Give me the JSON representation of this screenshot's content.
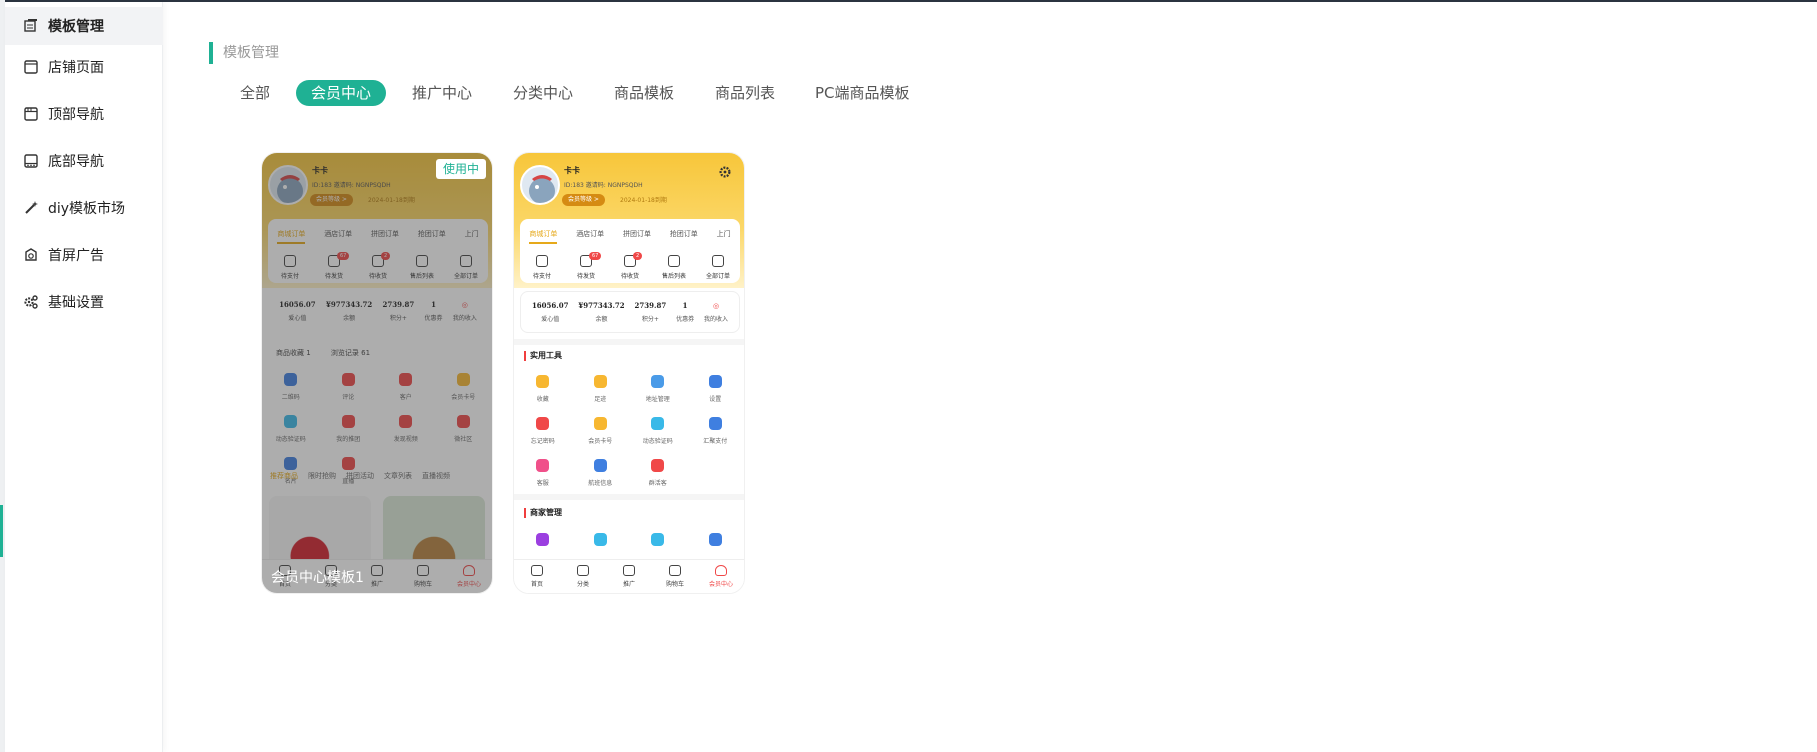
{
  "sidebar": {
    "items": [
      {
        "label": "模板管理",
        "icon": "template-icon",
        "active": true
      },
      {
        "label": "店铺页面",
        "icon": "page-icon",
        "active": false
      },
      {
        "label": "顶部导航",
        "icon": "top-nav-icon",
        "active": false
      },
      {
        "label": "底部导航",
        "icon": "bottom-nav-icon",
        "active": false
      },
      {
        "label": "diy模板市场",
        "icon": "magic-wand-icon",
        "active": false
      },
      {
        "label": "首屏广告",
        "icon": "ad-icon",
        "active": false
      },
      {
        "label": "基础设置",
        "icon": "gear-icon",
        "active": false
      }
    ]
  },
  "main": {
    "section_title": "模板管理",
    "tabs": [
      {
        "label": "全部",
        "active": false
      },
      {
        "label": "会员中心",
        "active": true
      },
      {
        "label": "推广中心",
        "active": false
      },
      {
        "label": "分类中心",
        "active": false
      },
      {
        "label": "商品模板",
        "active": false
      },
      {
        "label": "商品列表",
        "active": false
      },
      {
        "label": "PC端商品模板",
        "active": false
      }
    ]
  },
  "templates": [
    {
      "name": "会员中心模板1",
      "status": "使用中"
    },
    {
      "name": "",
      "status": ""
    }
  ],
  "phone": {
    "username": "卡卡",
    "meta": "ID:183   邀请码: NGNPSQDH",
    "copy": "复制",
    "level_badge": "会员等级 >",
    "expire": "2024-01-18到期",
    "order_tabs": [
      "商城订单",
      "酒店订单",
      "拼团订单",
      "抢团订单",
      "上门"
    ],
    "order_icons": [
      {
        "label": "待支付",
        "badge": ""
      },
      {
        "label": "待发货",
        "badge": "67"
      },
      {
        "label": "待收货",
        "badge": "2"
      },
      {
        "label": "售后列表",
        "badge": ""
      },
      {
        "label": "全部订单",
        "badge": ""
      }
    ],
    "stats": [
      {
        "value": "16056.07",
        "label": "爱心值"
      },
      {
        "value": "¥977343.72",
        "label": "余额"
      },
      {
        "value": "2739.87",
        "label": "积分+"
      },
      {
        "value": "1",
        "label": "优惠券"
      },
      {
        "value": "",
        "label": "我的收入"
      }
    ],
    "collect": [
      "商品收藏 1",
      "浏览记录 61"
    ],
    "tools_title": "实用工具",
    "tools": [
      {
        "label": "收藏",
        "color": "#f7b731"
      },
      {
        "label": "足迹",
        "color": "#f7b731"
      },
      {
        "label": "地址管理",
        "color": "#4a9be8"
      },
      {
        "label": "设置",
        "color": "#3f7fe0"
      },
      {
        "label": "忘记密码",
        "color": "#f04848"
      },
      {
        "label": "会员卡号",
        "color": "#f7b731"
      },
      {
        "label": "动态验证码",
        "color": "#39b9e8"
      },
      {
        "label": "汇聚支付",
        "color": "#3f7fe0"
      },
      {
        "label": "客服",
        "color": "#f0508a"
      },
      {
        "label": "航班信息",
        "color": "#3f7fe0"
      },
      {
        "label": "群活客",
        "color": "#f04848"
      }
    ],
    "merchant_title": "商家管理",
    "c1_grid": [
      {
        "label": "二维码",
        "color": "#3f7fe0"
      },
      {
        "label": "评论",
        "color": "#f04848"
      },
      {
        "label": "客户",
        "color": "#f04848"
      },
      {
        "label": "会员卡号",
        "color": "#f7b731"
      },
      {
        "label": "动态验证码",
        "color": "#39b9e8"
      },
      {
        "label": "我的推团",
        "color": "#f04848"
      },
      {
        "label": "发现视频",
        "color": "#f04848"
      },
      {
        "label": "微社区",
        "color": "#f04848"
      },
      {
        "label": "名片",
        "color": "#3f7fe0"
      },
      {
        "label": "直播",
        "color": "#f04848"
      }
    ],
    "product_tabs": [
      "推荐商品",
      "限时抢购",
      "拼团活动",
      "文章列表",
      "直播视频"
    ],
    "bottom_nav": [
      {
        "label": "首页",
        "active": false
      },
      {
        "label": "分类",
        "active": false
      },
      {
        "label": "推广",
        "active": false
      },
      {
        "label": "购物车",
        "active": false
      },
      {
        "label": "会员中心",
        "active": true
      }
    ]
  },
  "colors": {
    "accent": "#1fb194",
    "header_yellow": "#f7c63a",
    "badge_red": "#f04848"
  }
}
